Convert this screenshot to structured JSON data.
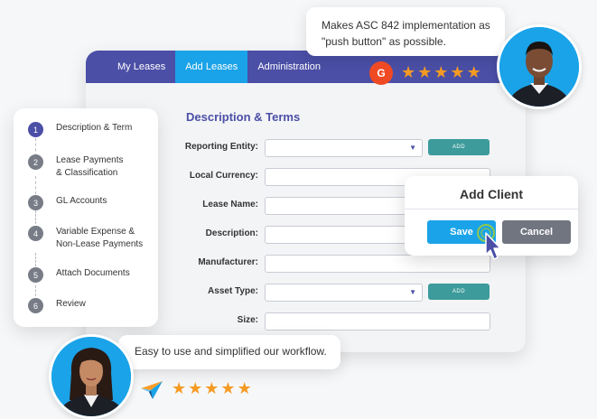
{
  "nav": {
    "tabs": [
      {
        "label": "My Leases",
        "active": false
      },
      {
        "label": "Add Leases",
        "active": true
      },
      {
        "label": "Administration",
        "active": false
      }
    ]
  },
  "form": {
    "title": "Description & Terms",
    "fields": [
      {
        "label": "Reporting Entity:",
        "type": "select",
        "add_button": "ADD"
      },
      {
        "label": "Local Currency:",
        "type": "text"
      },
      {
        "label": "Lease Name:",
        "type": "text"
      },
      {
        "label": "Description:",
        "type": "text"
      },
      {
        "label": "Manufacturer:",
        "type": "text"
      },
      {
        "label": "Asset Type:",
        "type": "select",
        "add_button": "ADD"
      },
      {
        "label": "Size:",
        "type": "text"
      }
    ]
  },
  "steps": [
    {
      "num": "1",
      "label": "Description & Term",
      "active": true
    },
    {
      "num": "2",
      "label": "Lease Payments & Classification",
      "active": false
    },
    {
      "num": "3",
      "label": "GL Accounts",
      "active": false
    },
    {
      "num": "4",
      "label": "Variable Expense & Non-Lease Payments",
      "active": false
    },
    {
      "num": "5",
      "label": "Attach Documents",
      "active": false
    },
    {
      "num": "6",
      "label": "Review",
      "active": false
    }
  ],
  "dialog": {
    "title": "Add Client",
    "save_label": "Save",
    "cancel_label": "Cancel"
  },
  "testimonials": {
    "top": {
      "quote": "Makes ASC 842 implementation as \"push button\" as possible.",
      "badge_letter": "G",
      "rating": 5
    },
    "bottom": {
      "quote": "Easy to use and simplified our workflow.",
      "rating": 5
    }
  },
  "colors": {
    "brand_purple": "#4b4fa6",
    "accent_blue": "#1aa3e8",
    "teal_button": "#3d9b9b",
    "star_orange": "#f59a23",
    "g2_red": "#ef4a24"
  }
}
